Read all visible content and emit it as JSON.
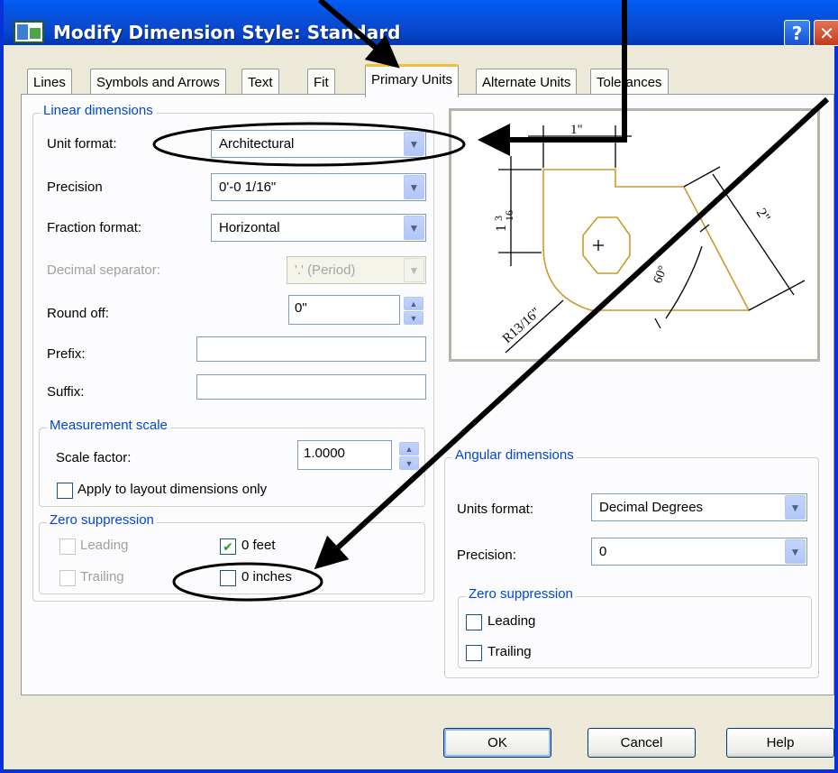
{
  "window": {
    "title": "Modify Dimension Style: Standard",
    "help_glyph": "?",
    "close_glyph": "✕"
  },
  "tabs": [
    {
      "label": "Lines",
      "active": false
    },
    {
      "label": "Symbols and Arrows",
      "active": false
    },
    {
      "label": "Text",
      "active": false
    },
    {
      "label": "Fit",
      "active": false
    },
    {
      "label": "Primary Units",
      "active": true
    },
    {
      "label": "Alternate Units",
      "active": false
    },
    {
      "label": "Tolerances",
      "active": false
    }
  ],
  "linear": {
    "group_label": "Linear dimensions",
    "unit_format": {
      "label": "Unit format:",
      "value": "Architectural"
    },
    "precision": {
      "label": "Precision",
      "value": "0'-0 1/16\""
    },
    "fraction_format": {
      "label": "Fraction format:",
      "value": "Horizontal"
    },
    "decimal_separator": {
      "label": "Decimal separator:",
      "value": "'.' (Period)"
    },
    "round_off": {
      "label": "Round off:",
      "value": "0\""
    },
    "prefix": {
      "label": "Prefix:",
      "value": ""
    },
    "suffix": {
      "label": "Suffix:",
      "value": ""
    }
  },
  "measurement": {
    "group_label": "Measurement scale",
    "scale_factor": {
      "label": "Scale factor:",
      "value": "1.0000"
    },
    "apply_layout": {
      "label": "Apply to layout dimensions only",
      "checked": false
    }
  },
  "zero_linear": {
    "group_label": "Zero suppression",
    "leading": {
      "label": "Leading",
      "checked": false,
      "enabled": false
    },
    "trailing": {
      "label": "Trailing",
      "checked": false,
      "enabled": false
    },
    "feet": {
      "label": "0 feet",
      "checked": true
    },
    "inches": {
      "label": "0 inches",
      "checked": false
    }
  },
  "preview": {
    "dim_top": "1\"",
    "dim_left_whole": "1",
    "dim_left_num": "3",
    "dim_left_den": "16",
    "dim_right": "2\"",
    "dim_angle": "60°",
    "dim_radius": "R13/16\""
  },
  "angular": {
    "group_label": "Angular dimensions",
    "units_format": {
      "label": "Units format:",
      "value": "Decimal Degrees"
    },
    "precision": {
      "label": "Precision:",
      "value": "0"
    },
    "zero_group_label": "Zero suppression",
    "leading": {
      "label": "Leading",
      "checked": false
    },
    "trailing": {
      "label": "Trailing",
      "checked": false
    }
  },
  "buttons": {
    "ok": "OK",
    "cancel": "Cancel",
    "help": "Help"
  },
  "colors": {
    "title_blue": "#0058ee",
    "group_label": "#0046d5",
    "preview_outline": "#c89a30"
  }
}
